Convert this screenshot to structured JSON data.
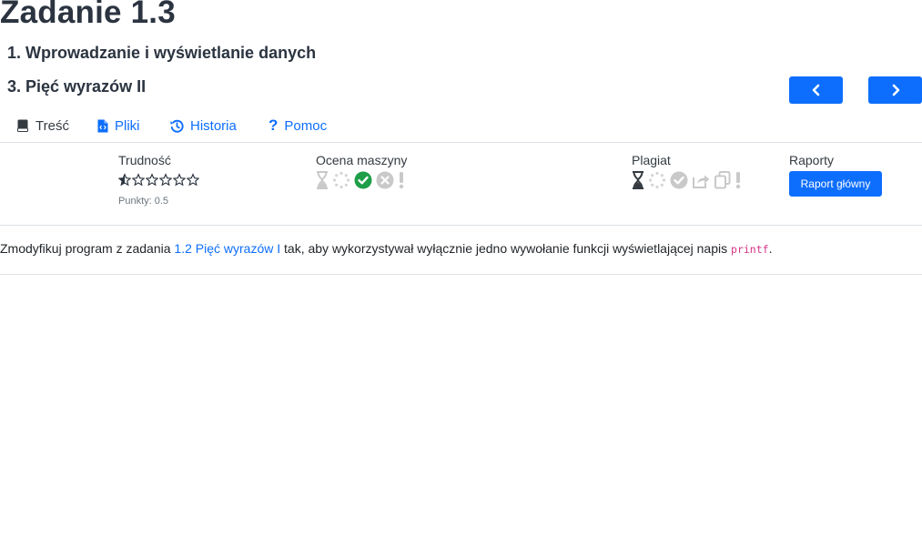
{
  "page": {
    "title_word": "Zadanie",
    "title_number": "1.3",
    "chapter": "1. Wprowadzanie i wyświetlanie danych",
    "task": "3. Pięć wyrazów II"
  },
  "nav": {
    "prev_icon": "chevron-left-icon",
    "next_icon": "chevron-right-icon"
  },
  "tabs": [
    {
      "label": "Treść",
      "icon": "book-icon",
      "active": true
    },
    {
      "label": "Pliki",
      "icon": "file-code-icon",
      "active": false
    },
    {
      "label": "Historia",
      "icon": "history-icon",
      "active": false
    },
    {
      "label": "Pomoc",
      "icon": "question-icon",
      "active": false
    }
  ],
  "info": {
    "difficulty_label": "Trudność",
    "difficulty_stars": 0.5,
    "difficulty_max": 6,
    "points": "Punkty: 0.5",
    "machine_label": "Ocena maszyny",
    "plagiarism_label": "Plagiat",
    "reports_label": "Raporty",
    "report_button": "Raport główny"
  },
  "colors": {
    "accent": "#0d6efd",
    "success": "#1e9e49",
    "muted_icon": "#c9c9c9",
    "dark_icon": "#343a40",
    "code": "#d63384"
  },
  "description": {
    "before": "Zmodyfikuj program z zadania ",
    "link": "1.2 Pięć wyrazów I",
    "after": " tak, aby wykorzystywał wyłącznie jedno wywołanie funkcji wyświetlającej napis ",
    "code": "printf",
    "end": "."
  }
}
